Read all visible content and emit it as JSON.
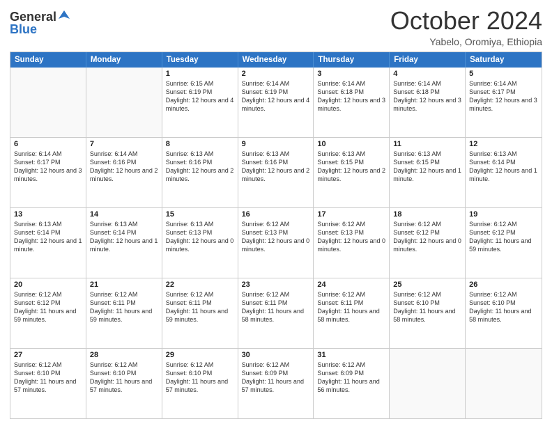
{
  "header": {
    "logo_line1": "General",
    "logo_line2": "Blue",
    "month_title": "October 2024",
    "location": "Yabelo, Oromiya, Ethiopia"
  },
  "days_of_week": [
    "Sunday",
    "Monday",
    "Tuesday",
    "Wednesday",
    "Thursday",
    "Friday",
    "Saturday"
  ],
  "weeks": [
    [
      {
        "day": "",
        "info": ""
      },
      {
        "day": "",
        "info": ""
      },
      {
        "day": "1",
        "info": "Sunrise: 6:15 AM\nSunset: 6:19 PM\nDaylight: 12 hours and 4 minutes."
      },
      {
        "day": "2",
        "info": "Sunrise: 6:14 AM\nSunset: 6:19 PM\nDaylight: 12 hours and 4 minutes."
      },
      {
        "day": "3",
        "info": "Sunrise: 6:14 AM\nSunset: 6:18 PM\nDaylight: 12 hours and 3 minutes."
      },
      {
        "day": "4",
        "info": "Sunrise: 6:14 AM\nSunset: 6:18 PM\nDaylight: 12 hours and 3 minutes."
      },
      {
        "day": "5",
        "info": "Sunrise: 6:14 AM\nSunset: 6:17 PM\nDaylight: 12 hours and 3 minutes."
      }
    ],
    [
      {
        "day": "6",
        "info": "Sunrise: 6:14 AM\nSunset: 6:17 PM\nDaylight: 12 hours and 3 minutes."
      },
      {
        "day": "7",
        "info": "Sunrise: 6:14 AM\nSunset: 6:16 PM\nDaylight: 12 hours and 2 minutes."
      },
      {
        "day": "8",
        "info": "Sunrise: 6:13 AM\nSunset: 6:16 PM\nDaylight: 12 hours and 2 minutes."
      },
      {
        "day": "9",
        "info": "Sunrise: 6:13 AM\nSunset: 6:16 PM\nDaylight: 12 hours and 2 minutes."
      },
      {
        "day": "10",
        "info": "Sunrise: 6:13 AM\nSunset: 6:15 PM\nDaylight: 12 hours and 2 minutes."
      },
      {
        "day": "11",
        "info": "Sunrise: 6:13 AM\nSunset: 6:15 PM\nDaylight: 12 hours and 1 minute."
      },
      {
        "day": "12",
        "info": "Sunrise: 6:13 AM\nSunset: 6:14 PM\nDaylight: 12 hours and 1 minute."
      }
    ],
    [
      {
        "day": "13",
        "info": "Sunrise: 6:13 AM\nSunset: 6:14 PM\nDaylight: 12 hours and 1 minute."
      },
      {
        "day": "14",
        "info": "Sunrise: 6:13 AM\nSunset: 6:14 PM\nDaylight: 12 hours and 1 minute."
      },
      {
        "day": "15",
        "info": "Sunrise: 6:13 AM\nSunset: 6:13 PM\nDaylight: 12 hours and 0 minutes."
      },
      {
        "day": "16",
        "info": "Sunrise: 6:12 AM\nSunset: 6:13 PM\nDaylight: 12 hours and 0 minutes."
      },
      {
        "day": "17",
        "info": "Sunrise: 6:12 AM\nSunset: 6:13 PM\nDaylight: 12 hours and 0 minutes."
      },
      {
        "day": "18",
        "info": "Sunrise: 6:12 AM\nSunset: 6:12 PM\nDaylight: 12 hours and 0 minutes."
      },
      {
        "day": "19",
        "info": "Sunrise: 6:12 AM\nSunset: 6:12 PM\nDaylight: 11 hours and 59 minutes."
      }
    ],
    [
      {
        "day": "20",
        "info": "Sunrise: 6:12 AM\nSunset: 6:12 PM\nDaylight: 11 hours and 59 minutes."
      },
      {
        "day": "21",
        "info": "Sunrise: 6:12 AM\nSunset: 6:11 PM\nDaylight: 11 hours and 59 minutes."
      },
      {
        "day": "22",
        "info": "Sunrise: 6:12 AM\nSunset: 6:11 PM\nDaylight: 11 hours and 59 minutes."
      },
      {
        "day": "23",
        "info": "Sunrise: 6:12 AM\nSunset: 6:11 PM\nDaylight: 11 hours and 58 minutes."
      },
      {
        "day": "24",
        "info": "Sunrise: 6:12 AM\nSunset: 6:11 PM\nDaylight: 11 hours and 58 minutes."
      },
      {
        "day": "25",
        "info": "Sunrise: 6:12 AM\nSunset: 6:10 PM\nDaylight: 11 hours and 58 minutes."
      },
      {
        "day": "26",
        "info": "Sunrise: 6:12 AM\nSunset: 6:10 PM\nDaylight: 11 hours and 58 minutes."
      }
    ],
    [
      {
        "day": "27",
        "info": "Sunrise: 6:12 AM\nSunset: 6:10 PM\nDaylight: 11 hours and 57 minutes."
      },
      {
        "day": "28",
        "info": "Sunrise: 6:12 AM\nSunset: 6:10 PM\nDaylight: 11 hours and 57 minutes."
      },
      {
        "day": "29",
        "info": "Sunrise: 6:12 AM\nSunset: 6:10 PM\nDaylight: 11 hours and 57 minutes."
      },
      {
        "day": "30",
        "info": "Sunrise: 6:12 AM\nSunset: 6:09 PM\nDaylight: 11 hours and 57 minutes."
      },
      {
        "day": "31",
        "info": "Sunrise: 6:12 AM\nSunset: 6:09 PM\nDaylight: 11 hours and 56 minutes."
      },
      {
        "day": "",
        "info": ""
      },
      {
        "day": "",
        "info": ""
      }
    ]
  ]
}
